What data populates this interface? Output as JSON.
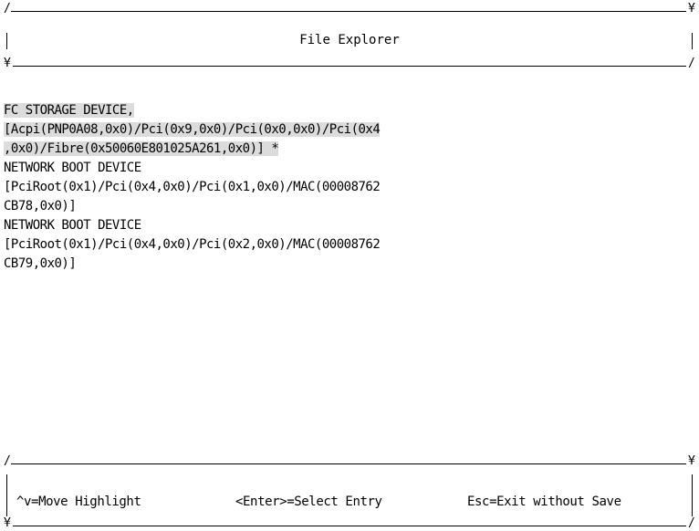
{
  "header": {
    "title": "File Explorer"
  },
  "entries": [
    {
      "selected": true,
      "lines": [
        "FC STORAGE DEVICE,",
        "[Acpi(PNP0A08,0x0)/Pci(0x9,0x0)/Pci(0x0,0x0)/Pci(0x4",
        ",0x0)/Fibre(0x50060E801025A261,0x0)] *"
      ]
    },
    {
      "selected": false,
      "lines": [
        "NETWORK BOOT DEVICE",
        "[PciRoot(0x1)/Pci(0x4,0x0)/Pci(0x1,0x0)/MAC(00008762",
        "CB78,0x0)]"
      ]
    },
    {
      "selected": false,
      "lines": [
        "NETWORK BOOT DEVICE",
        "[PciRoot(0x1)/Pci(0x4,0x0)/Pci(0x2,0x0)/MAC(00008762",
        "CB79,0x0)]"
      ]
    }
  ],
  "footer": {
    "move_hint": "^v=Move Highlight",
    "enter_hint": "<Enter>=Select Entry",
    "esc_hint": "Esc=Exit without Save"
  },
  "frame": {
    "corner_top_left": "/",
    "corner_top_right": "¥",
    "corner_bottom_left": "¥",
    "corner_bottom_right": "/",
    "vertical": "|"
  },
  "colors": {
    "background": "#ffffff",
    "text": "#000000",
    "highlight": "#dcdcdc"
  }
}
